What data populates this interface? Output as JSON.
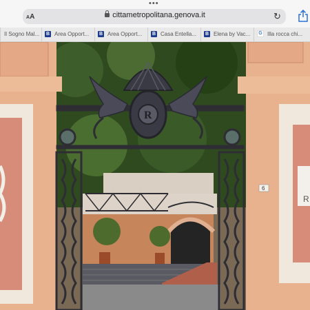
{
  "browser": {
    "aa_label": "AA",
    "url": "cittametropolitana.genova.it",
    "reload_icon": "reload-icon",
    "share_icon": "share-icon"
  },
  "tabs": [
    {
      "label": "Il Sogno Mal...",
      "favicon": "",
      "fav_style": ""
    },
    {
      "label": "Area Opport...",
      "favicon": "B",
      "fav_style": "b"
    },
    {
      "label": "Area Opport...",
      "favicon": "B",
      "fav_style": "b"
    },
    {
      "label": "Casa Entella...",
      "favicon": "B",
      "fav_style": "b"
    },
    {
      "label": "Elena by Vac...",
      "favicon": "B",
      "fav_style": "b"
    },
    {
      "label": "Illa rocca chi...",
      "favicon": "G",
      "fav_style": "g"
    }
  ],
  "photo": {
    "gate_monogram": "R",
    "house_number": "6",
    "right_sign_text": "R",
    "colors": {
      "pillar": "#e8b28f",
      "panel": "#d78b79",
      "sky_trees": "#2f4a1f",
      "gate": "#2d2d33"
    }
  }
}
